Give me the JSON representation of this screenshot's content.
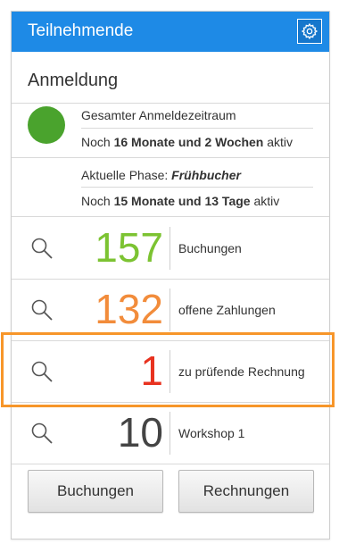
{
  "header": {
    "title": "Teilnehmende",
    "settings_icon": "gear-icon"
  },
  "section": {
    "title": "Anmeldung"
  },
  "registration": {
    "status_color": "#4aa32d",
    "period_label": "Gesamter Anmeldezeitraum",
    "period_prefix": "Noch ",
    "period_value": "16 Monate und 2 Wochen",
    "period_suffix": " aktiv",
    "phase_label": "Aktuelle Phase: ",
    "phase_value": "Frühbucher",
    "phase_prefix": "Noch ",
    "phase_remaining": "15 Monate und 13 Tage",
    "phase_suffix": " aktiv"
  },
  "stats": [
    {
      "count": "157",
      "label": "Buchungen",
      "color": "#7cc332",
      "icon": "search-icon"
    },
    {
      "count": "132",
      "label": "offene Zahlungen",
      "color": "#f28c3b",
      "icon": "search-icon"
    },
    {
      "count": "1",
      "label": "zu prüfende Rechnung",
      "color": "#e8321f",
      "icon": "search-icon"
    },
    {
      "count": "10",
      "label": "Workshop 1",
      "color": "#444444",
      "icon": "search-icon"
    }
  ],
  "buttons": {
    "bookings": "Buchungen",
    "invoices": "Rechnungen"
  },
  "highlight_color": "#f7962a"
}
